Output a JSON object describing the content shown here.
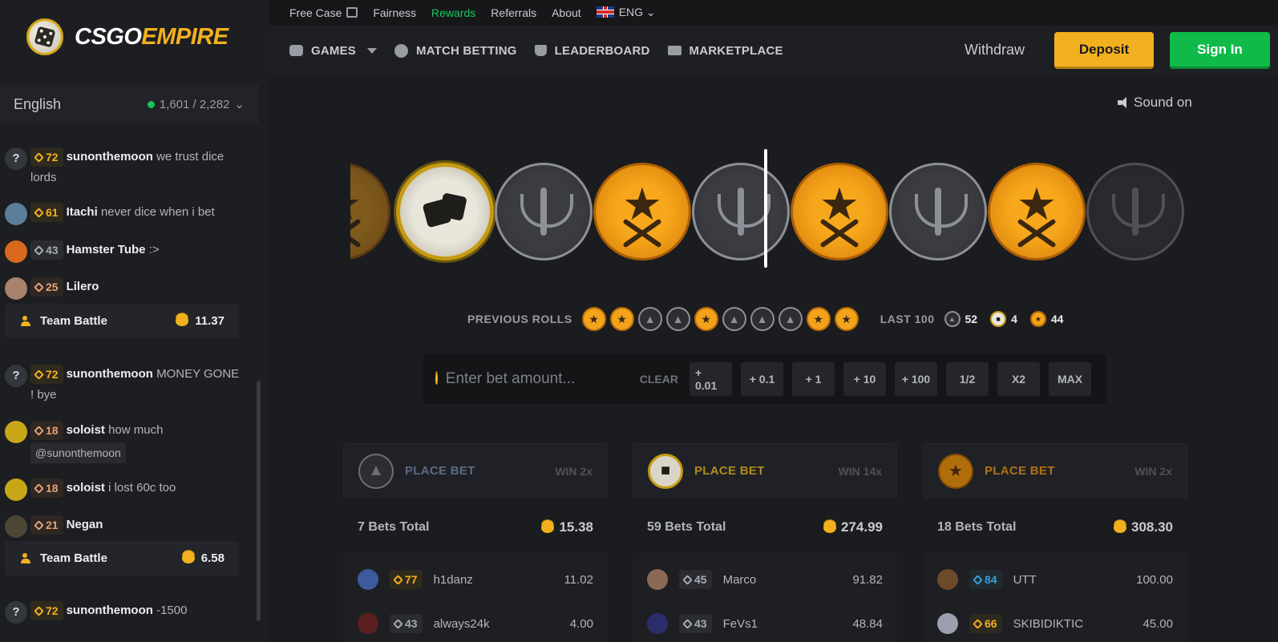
{
  "brand": {
    "part1": "CSGO",
    "part2": "EMPIRE"
  },
  "chat_header": {
    "language": "English",
    "online": "1,601 / 2,282"
  },
  "chat": [
    {
      "avatar": "?",
      "level": "72",
      "tier": "gold",
      "name": "sunonthemoon",
      "text": "we trust dice lords"
    },
    {
      "avatar": "",
      "level": "61",
      "tier": "gold",
      "name": "Itachi",
      "text": "never dice when i bet"
    },
    {
      "avatar": "",
      "level": "43",
      "tier": "silver",
      "name": "Hamster Tube",
      "text": ":>"
    },
    {
      "avatar": "",
      "level": "25",
      "tier": "bronze",
      "name": "Lilero",
      "text": ""
    },
    {
      "avatar": "?",
      "level": "72",
      "tier": "gold",
      "name": "sunonthemoon",
      "text": "MONEY GONE ! bye"
    },
    {
      "avatar": "",
      "level": "18",
      "tier": "bronze",
      "name": "soloist",
      "text": "how much",
      "mention": "@sunonthemoon"
    },
    {
      "avatar": "",
      "level": "18",
      "tier": "bronze",
      "name": "soloist",
      "text": "i lost 60c too"
    },
    {
      "avatar": "",
      "level": "21",
      "tier": "bronze",
      "name": "Negan",
      "text": ""
    },
    {
      "avatar": "?",
      "level": "72",
      "tier": "gold",
      "name": "sunonthemoon",
      "text": "-1500"
    }
  ],
  "team_battles": [
    {
      "label": "Team Battle",
      "amount": "11.37"
    },
    {
      "label": "Team Battle",
      "amount": "6.58"
    }
  ],
  "topnav": {
    "free_case": "Free Case",
    "fairness": "Fairness",
    "rewards": "Rewards",
    "referrals": "Referrals",
    "about": "About",
    "lang": "ENG"
  },
  "mainnav": {
    "games": "GAMES",
    "match_betting": "MATCH BETTING",
    "leaderboard": "LEADERBOARD",
    "marketplace": "MARKETPLACE"
  },
  "actions": {
    "withdraw": "Withdraw",
    "deposit": "Deposit",
    "signin": "Sign In"
  },
  "sound": "Sound on",
  "roulette": [
    "t",
    "bonus",
    "ct",
    "t",
    "ct",
    "t",
    "ct",
    "t",
    "ct"
  ],
  "previous_rolls": {
    "label": "PREVIOUS ROLLS",
    "rolls": [
      "t",
      "t",
      "ct",
      "ct",
      "t",
      "ct",
      "ct",
      "ct",
      "t",
      "t"
    ]
  },
  "last100": {
    "label": "LAST 100",
    "ct": "52",
    "bonus": "4",
    "t": "44"
  },
  "bet_input": {
    "placeholder": "Enter bet amount...",
    "clear": "CLEAR",
    "buttons": [
      "+ 0.01",
      "+ 0.1",
      "+ 1",
      "+ 10",
      "+ 100",
      "1/2",
      "X2",
      "MAX"
    ]
  },
  "columns": [
    {
      "type": "ct",
      "place": "PLACE BET",
      "win": "WIN 2x",
      "total_label": "7 Bets Total",
      "total": "15.38",
      "bettors": [
        {
          "level": "77",
          "tier": "gold",
          "name": "h1danz",
          "amount": "11.02"
        },
        {
          "level": "43",
          "tier": "silver",
          "name": "always24k",
          "amount": "4.00"
        }
      ]
    },
    {
      "type": "bonus",
      "place": "PLACE BET",
      "win": "WIN 14x",
      "total_label": "59 Bets Total",
      "total": "274.99",
      "bettors": [
        {
          "level": "45",
          "tier": "silver",
          "name": "Marco",
          "amount": "91.82"
        },
        {
          "level": "43",
          "tier": "silver",
          "name": "FeVs1",
          "amount": "48.84"
        }
      ]
    },
    {
      "type": "t",
      "place": "PLACE BET",
      "win": "WIN 2x",
      "total_label": "18 Bets Total",
      "total": "308.30",
      "bettors": [
        {
          "level": "84",
          "tier": "blue",
          "name": "UTT",
          "amount": "100.00"
        },
        {
          "level": "66",
          "tier": "gold",
          "name": "SKIBIDIKTIC",
          "amount": "45.00"
        }
      ]
    }
  ]
}
